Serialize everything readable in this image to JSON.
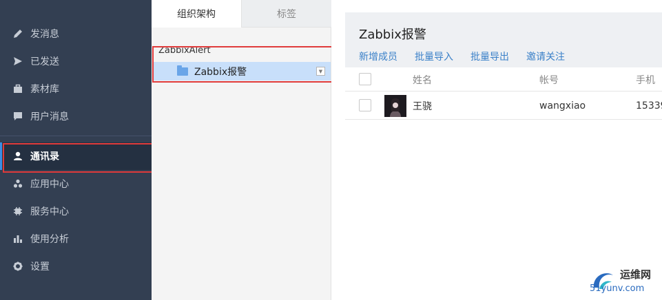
{
  "sidebar": {
    "items": [
      {
        "label": "发消息",
        "icon": "pencil-icon"
      },
      {
        "label": "已发送",
        "icon": "send-icon"
      },
      {
        "label": "素材库",
        "icon": "briefcase-icon"
      },
      {
        "label": "用户消息",
        "icon": "chat-icon"
      },
      {
        "label": "通讯录",
        "icon": "user-icon",
        "active": true
      },
      {
        "label": "应用中心",
        "icon": "apps-icon"
      },
      {
        "label": "服务中心",
        "icon": "chip-icon"
      },
      {
        "label": "使用分析",
        "icon": "bar-chart-icon"
      },
      {
        "label": "设置",
        "icon": "gear-icon"
      }
    ]
  },
  "tree": {
    "tabs": [
      "组织架构",
      "标签"
    ],
    "root": "ZabbixAlert",
    "node": "Zabbix报警"
  },
  "main": {
    "title": "Zabbix报警",
    "actions": [
      "新增成员",
      "批量导入",
      "批量导出",
      "邀请关注"
    ],
    "columns": [
      "姓名",
      "帐号",
      "手机"
    ],
    "rows": [
      {
        "name": "王骁",
        "account": "wangxiao",
        "phone": "15339"
      }
    ]
  },
  "watermark": {
    "title": "运维网",
    "url": "51yunv.com"
  },
  "colors": {
    "sidebar_bg": "#333f52",
    "active_bg": "#243041",
    "link": "#3a80c8",
    "highlight_box": "#e03a3a",
    "selected_node": "#c8dffa"
  }
}
